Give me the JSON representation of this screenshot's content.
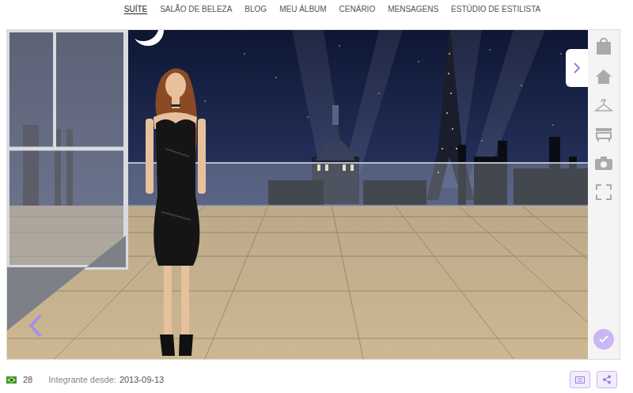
{
  "nav": {
    "items": [
      {
        "label": "SUÍTE",
        "selected": true
      },
      {
        "label": "SALÃO DE BELEZA",
        "selected": false
      },
      {
        "label": "BLOG",
        "selected": false
      },
      {
        "label": "MEU ÁLBUM",
        "selected": false
      },
      {
        "label": "CENÁRIO",
        "selected": false
      },
      {
        "label": "MENSAGENS",
        "selected": false
      },
      {
        "label": "ESTÚDIO DE ESTILISTA",
        "selected": false
      }
    ]
  },
  "profile": {
    "age": "28",
    "member_since_label": "Integrante desde:",
    "member_since": "2013-09-13"
  }
}
